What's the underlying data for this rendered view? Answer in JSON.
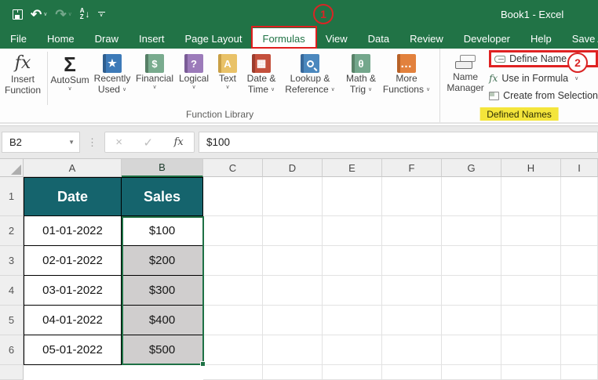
{
  "titlebar": {
    "title": "Book1 - Excel"
  },
  "qat_icons": {
    "undo": "↶",
    "redo": "↷",
    "sort_a": "A",
    "sort_z": "Z",
    "sort_arrow": "↓"
  },
  "tabs": [
    {
      "label": "File"
    },
    {
      "label": "Home"
    },
    {
      "label": "Draw"
    },
    {
      "label": "Insert"
    },
    {
      "label": "Page Layout"
    },
    {
      "label": "Formulas",
      "selected": true
    },
    {
      "label": "View"
    },
    {
      "label": "Data"
    },
    {
      "label": "Review"
    },
    {
      "label": "Developer"
    },
    {
      "label": "Help"
    },
    {
      "label": "Save As"
    }
  ],
  "annotations": {
    "step1": "1",
    "step2": "2"
  },
  "ribbon": {
    "function_library": {
      "label": "Function Library",
      "insert_function": {
        "glyph": "fx",
        "line1": "Insert",
        "line2": "Function"
      },
      "items": [
        {
          "glyph": "Σ",
          "line1": "AutoSum",
          "line2": ""
        },
        {
          "glyph": "★",
          "line1": "Recently",
          "line2": "Used"
        },
        {
          "glyph": "$",
          "line1": "Financial",
          "line2": ""
        },
        {
          "glyph": "?",
          "line1": "Logical",
          "line2": ""
        },
        {
          "glyph": "A",
          "line1": "Text",
          "line2": ""
        },
        {
          "glyph": "▦",
          "line1": "Date &",
          "line2": "Time"
        },
        {
          "glyph": "",
          "line1": "Lookup &",
          "line2": "Reference"
        },
        {
          "glyph": "θ",
          "line1": "Math &",
          "line2": "Trig"
        },
        {
          "glyph": "…",
          "line1": "More",
          "line2": "Functions"
        }
      ]
    },
    "defined_names": {
      "label": "Defined Names",
      "name_manager": {
        "line1": "Name",
        "line2": "Manager"
      },
      "define_name": "Define Name",
      "use_in_formula": "Use in Formula",
      "create_from_selection": "Create from Selection",
      "use_in_formula_glyph": "fx"
    }
  },
  "formula_bar": {
    "name_box": "B2",
    "formula": "$100",
    "cancel": "×",
    "enter": "✓",
    "fx": "fx",
    "dropdown": "▼",
    "dots": "⋮"
  },
  "grid": {
    "column_headers": [
      "A",
      "B",
      "C",
      "D",
      "E",
      "F",
      "G",
      "H",
      "I"
    ],
    "selected_column": "B",
    "row_headers": [
      "1",
      "2",
      "3",
      "4",
      "5",
      "6"
    ],
    "active_cell": "B2",
    "selection": "B2:B6",
    "table": {
      "headers": [
        "Date",
        "Sales"
      ],
      "rows": [
        {
          "date": "01-01-2022",
          "sales": "$100"
        },
        {
          "date": "02-01-2022",
          "sales": "$200"
        },
        {
          "date": "03-01-2022",
          "sales": "$300"
        },
        {
          "date": "04-01-2022",
          "sales": "$400"
        },
        {
          "date": "05-01-2022",
          "sales": "$500"
        }
      ]
    }
  },
  "colors": {
    "excel_green": "#217346",
    "table_header_teal": "#15646D",
    "selection_fill": "#D0CECE",
    "selection_border": "#1E7145",
    "annotation_red": "#DF2222",
    "highlight_yellow": "#F4E53B"
  }
}
